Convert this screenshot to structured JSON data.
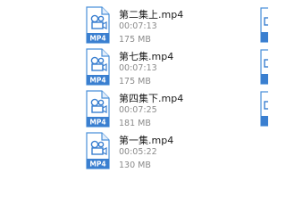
{
  "file_type": {
    "icon": "mp4-video-file-icon",
    "badge": "MP4",
    "accent": "#4a90d9"
  },
  "files": [
    {
      "name": "第二集上.mp4",
      "duration": "00:07:13",
      "size": "175 MB"
    },
    {
      "name": "第七集.mp4",
      "duration": "00:07:13",
      "size": "175 MB"
    },
    {
      "name": "第四集下.mp4",
      "duration": "00:07:25",
      "size": "181 MB"
    },
    {
      "name": "第一集.mp4",
      "duration": "00:05:22",
      "size": "130 MB"
    }
  ]
}
